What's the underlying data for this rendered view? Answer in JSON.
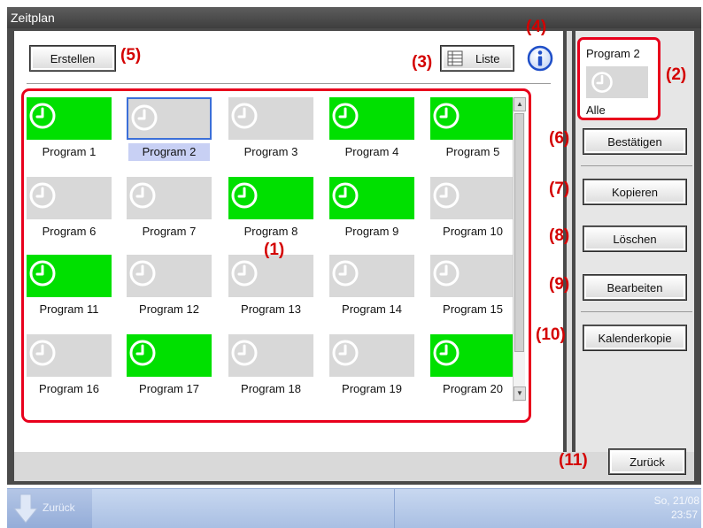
{
  "window": {
    "title": "Zeitplan"
  },
  "toolbar": {
    "create_label": "Erstellen",
    "list_label": "Liste"
  },
  "grid": {
    "items": [
      {
        "label": "Program 1",
        "active": true
      },
      {
        "label": "Program 2",
        "active": false,
        "selected": true
      },
      {
        "label": "Program 3",
        "active": false
      },
      {
        "label": "Program 4",
        "active": true
      },
      {
        "label": "Program 5",
        "active": true
      },
      {
        "label": "Program 6",
        "active": false
      },
      {
        "label": "Program 7",
        "active": false
      },
      {
        "label": "Program 8",
        "active": true
      },
      {
        "label": "Program 9",
        "active": true
      },
      {
        "label": "Program 10",
        "active": false
      },
      {
        "label": "Program 11",
        "active": true
      },
      {
        "label": "Program 12",
        "active": false
      },
      {
        "label": "Program 13",
        "active": false
      },
      {
        "label": "Program 14",
        "active": false
      },
      {
        "label": "Program 15",
        "active": false
      },
      {
        "label": "Program 16",
        "active": false
      },
      {
        "label": "Program 17",
        "active": true
      },
      {
        "label": "Program 18",
        "active": false
      },
      {
        "label": "Program 19",
        "active": false
      },
      {
        "label": "Program 20",
        "active": true
      }
    ]
  },
  "detail": {
    "title": "Program 2",
    "subtitle": "Alle"
  },
  "actions": {
    "confirm": "Bestätigen",
    "copy": "Kopieren",
    "delete": "Löschen",
    "edit": "Bearbeiten",
    "calendar_copy": "Kalenderkopie",
    "back": "Zurück"
  },
  "callouts": {
    "c1": "(1)",
    "c2": "(2)",
    "c3": "(3)",
    "c4": "(4)",
    "c5": "(5)",
    "c6": "(6)",
    "c7": "(7)",
    "c8": "(8)",
    "c9": "(9)",
    "c10": "(10)",
    "c11": "(11)"
  },
  "taskbar": {
    "back_label": "Zurück",
    "datetime": "So, 21/08",
    "time": "23:57"
  },
  "colors": {
    "active": "#00e000",
    "inactive": "#d8d8d8",
    "callout": "#d40000",
    "selected_label": "#c8d0f4"
  },
  "icons": {
    "clock": "clock-icon",
    "list": "list-icon",
    "info": "info-icon",
    "down_arrow": "down-arrow-icon"
  }
}
